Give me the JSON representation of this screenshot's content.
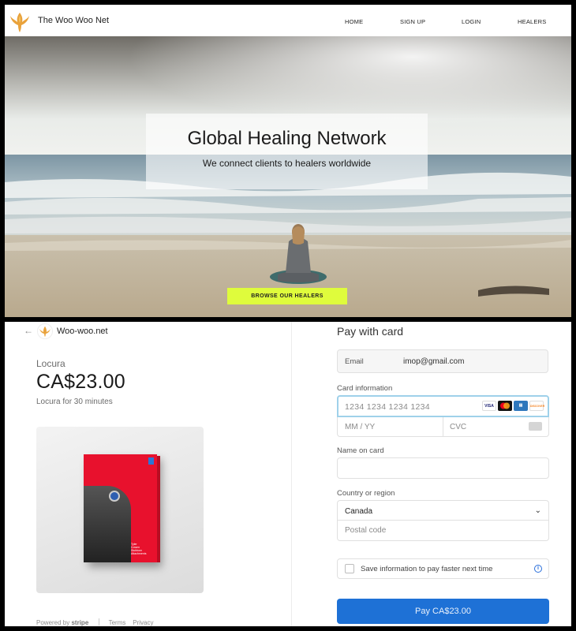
{
  "site": {
    "brand": "The Woo Woo Net",
    "nav": [
      "HOME",
      "SIGN UP",
      "LOGIN",
      "HEALERS"
    ],
    "hero_title": "Global Healing Network",
    "hero_subtitle": "We connect clients to healers worldwide",
    "browse_button": "BROWSE OUR HEALERS"
  },
  "checkout": {
    "merchant": "Woo-woo.net",
    "product_name": "Locura",
    "price": "CA$23.00",
    "price_desc": "Locura for 30 minutes",
    "book_text": "Tyler\nCowen\nStubborn\nAttachments",
    "footer": {
      "powered": "Powered by",
      "stripe": "stripe",
      "terms": "Terms",
      "privacy": "Privacy"
    },
    "pay_title": "Pay with card",
    "email_label": "Email",
    "email_value": "imop@gmail.com",
    "card_info_label": "Card information",
    "card_number_placeholder": "1234 1234 1234 1234",
    "card_brands": [
      "VISA",
      "MC",
      "AMEX",
      "DISCOVER"
    ],
    "expiry_placeholder": "MM / YY",
    "cvc_placeholder": "CVC",
    "name_label": "Name on card",
    "name_value": "",
    "country_label": "Country or region",
    "country_value": "Canada",
    "postal_placeholder": "Postal code",
    "save_info": "Save information to pay faster next time",
    "pay_button": "Pay CA$23.00"
  },
  "colors": {
    "accent_green": "#dffc3c",
    "pay_blue": "#1e71d6",
    "focus_border": "#9fd1ea"
  }
}
